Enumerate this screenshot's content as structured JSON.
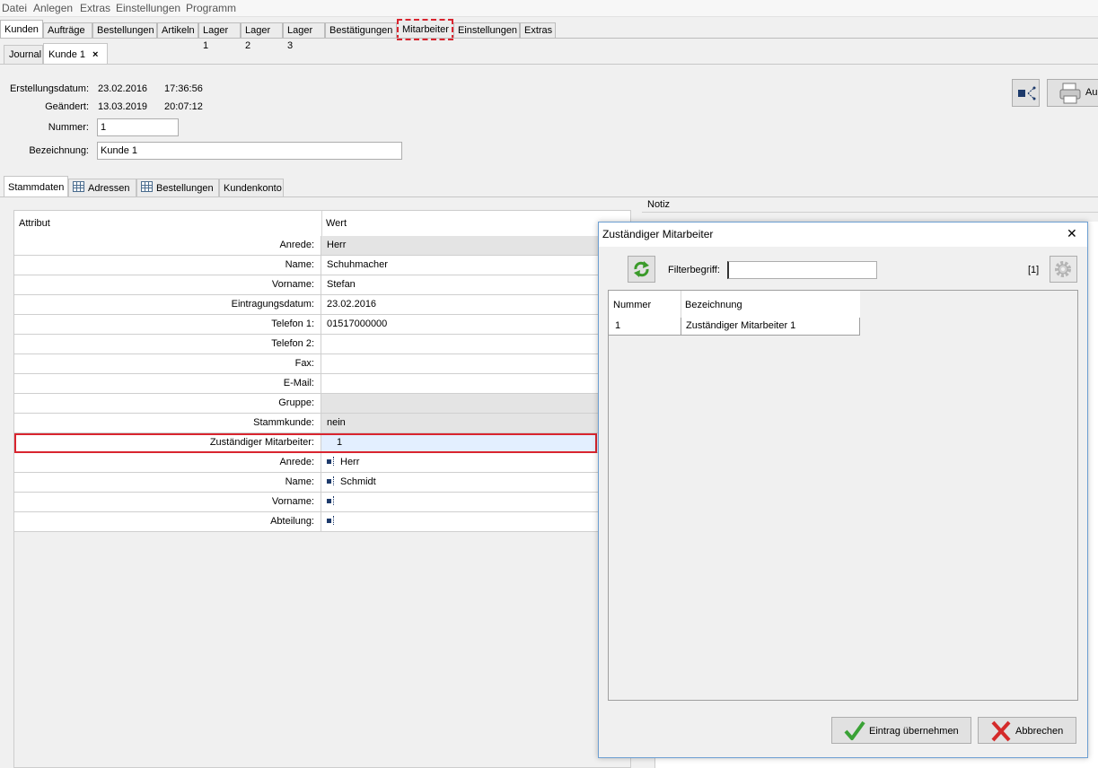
{
  "menu": [
    "Datei",
    "Anlegen",
    "Extras",
    "Einstellungen",
    "Programm"
  ],
  "main_tabs": [
    "Kunden",
    "Aufträge",
    "Bestellungen",
    "Artikeln",
    "Lager 1",
    "Lager 2",
    "Lager 3",
    "Bestätigungen",
    "Mitarbeiter",
    "Einstellungen",
    "Extras"
  ],
  "doc_tabs": {
    "journal": "Journal",
    "kunde": "Kunde 1",
    "close": "×"
  },
  "header": {
    "erstellung_label": "Erstellungsdatum:",
    "erstellung_date": "23.02.2016",
    "erstellung_time": "17:36:56",
    "geaendert_label": "Geändert:",
    "geaendert_date": "13.03.2019",
    "geaendert_time": "20:07:12",
    "nummer_label": "Nummer:",
    "nummer_value": "1",
    "bezeichnung_label": "Bezeichnung:",
    "bezeichnung_value": "Kunde 1"
  },
  "toolbar": {
    "print_label": "Au"
  },
  "sub_tabs": [
    "Stammdaten",
    "Adressen",
    "Bestellungen",
    "Kundenkonto"
  ],
  "notiz_label": "Notiz",
  "table": {
    "col_attribut": "Attribut",
    "col_wert": "Wert",
    "rows": [
      {
        "attr": "Anrede:",
        "value": "Herr"
      },
      {
        "attr": "Name:",
        "value": "Schuhmacher"
      },
      {
        "attr": "Vorname:",
        "value": "Stefan"
      },
      {
        "attr": "Eintragungsdatum:",
        "value": "23.02.2016"
      },
      {
        "attr": "Telefon 1:",
        "value": "01517000000"
      },
      {
        "attr": "Telefon 2:",
        "value": ""
      },
      {
        "attr": "Fax:",
        "value": ""
      },
      {
        "attr": "E-Mail:",
        "value": ""
      },
      {
        "attr": "Gruppe:",
        "value": ""
      },
      {
        "attr": "Stammkunde:",
        "value": "nein"
      },
      {
        "attr": "Zuständiger Mitarbeiter:",
        "value": "1"
      },
      {
        "attr": "Anrede:",
        "value": "Herr"
      },
      {
        "attr": "Name:",
        "value": "Schmidt"
      },
      {
        "attr": "Vorname:",
        "value": ""
      },
      {
        "attr": "Abteilung:",
        "value": ""
      }
    ]
  },
  "dialog": {
    "title": "Zuständiger Mitarbeiter",
    "close": "✕",
    "filter_label": "Filterbegriff:",
    "filter_value": "",
    "count": "[1]",
    "col_nummer": "Nummer",
    "col_bezeichnung": "Bezeichnung",
    "rows": [
      {
        "nummer": "1",
        "bezeichnung": "Zuständiger Mitarbeiter 1"
      }
    ],
    "ok_label": "Eintrag übernehmen",
    "cancel_label": "Abbrechen"
  },
  "colors": {
    "highlight": "#d9252f",
    "selection": "#e3efff",
    "accent": "#1d3a6b"
  }
}
